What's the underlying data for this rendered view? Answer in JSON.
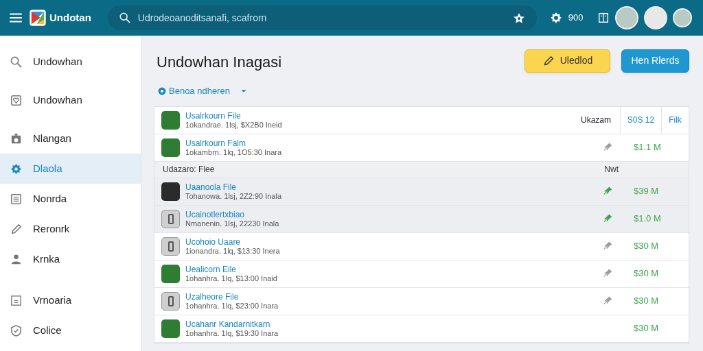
{
  "app": {
    "name": "Undotan"
  },
  "search": {
    "placeholder": "Udrodeoanoditsanafi, scafrorn"
  },
  "header": {
    "count": "900"
  },
  "sidebar": {
    "items": [
      {
        "label": "Undowhan",
        "kind": "search",
        "selected": false
      },
      {
        "label": "Undowhan",
        "kind": "picture",
        "selected": false
      },
      {
        "label": "Nlangan",
        "kind": "camera",
        "selected": false
      },
      {
        "label": "Dlaola",
        "kind": "gear",
        "selected": true
      },
      {
        "label": "Nonrda",
        "kind": "list",
        "selected": false
      },
      {
        "label": "Reronrk",
        "kind": "pencil",
        "selected": false
      },
      {
        "label": "Krnka",
        "kind": "person",
        "selected": false
      },
      {
        "label": "Vrnoaria",
        "kind": "document",
        "selected": false
      },
      {
        "label": "Colice",
        "kind": "shield",
        "selected": false
      }
    ]
  },
  "page": {
    "title": "Undowhan Inagasi",
    "buttons": [
      {
        "label": "Uledlod",
        "kind": "warning"
      },
      {
        "label": "Hen Rlerds",
        "kind": "primary"
      }
    ],
    "filter": {
      "label": "Benoa ndheren"
    }
  },
  "table": {
    "rows": [
      {
        "kind": "item",
        "thumbnail": {
          "kind": "photo"
        },
        "name": "Usalrkourn File",
        "meta": "1okandrae. 1lsj, $X2B0 Ineid",
        "cells": [
          "Ukazam",
          "S0S 12",
          "Filk"
        ],
        "highlighted": false
      },
      {
        "kind": "item",
        "thumbnail": {
          "kind": "photo"
        },
        "name": "Usalrkourn Falm",
        "meta": "1okambrn. 1lq, 1O5:30 Inara",
        "pin": {
          "active": false
        },
        "price": "$1.1 M",
        "highlighted": false
      },
      {
        "kind": "group",
        "label": "Udazaro: Flee",
        "column": "Nwt"
      },
      {
        "kind": "item",
        "thumbnail": {
          "kind": "dark-photo"
        },
        "name": "Uaanoola File",
        "meta": "Tohanowa. 1lsj, 2Z2:90 Inala",
        "pin": {
          "active": true
        },
        "price": "$39 M",
        "highlighted": true
      },
      {
        "kind": "item",
        "thumbnail": {
          "kind": "device"
        },
        "name": "Ucainotlertxbiao",
        "meta": "Nmanenin. 1lsj, 22230 Inala",
        "pin": {
          "active": true
        },
        "price": "$1.0 M",
        "highlighted": true
      },
      {
        "kind": "item",
        "thumbnail": {
          "kind": "device"
        },
        "name": "Ucohoio Uaare",
        "meta": "1ionandra. 1lq, $13:30 Inera",
        "pin": {
          "active": false
        },
        "price": "$30 M",
        "highlighted": false
      },
      {
        "kind": "item",
        "thumbnail": {
          "kind": "photo"
        },
        "name": "Uealicorn Eile",
        "meta": "1ohanhra. 1lq, $13:00 Inaid",
        "pin": {
          "active": false
        },
        "price": "$30 M",
        "highlighted": false
      },
      {
        "kind": "item",
        "thumbnail": {
          "kind": "device"
        },
        "name": "Uzalheore File",
        "meta": "1ohanhra. 1lq, $23:00 Inara",
        "pin": {
          "active": false
        },
        "price": "$30 M",
        "highlighted": false
      },
      {
        "kind": "item",
        "thumbnail": {
          "kind": "photo"
        },
        "name": "Ucahanr Kandarnitkarn",
        "meta": "1ohanhra. 1lq, $19:30 Inara",
        "price": "$30 M",
        "highlighted": false
      }
    ]
  }
}
